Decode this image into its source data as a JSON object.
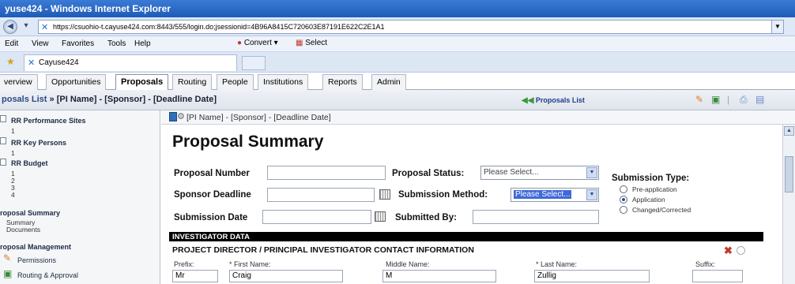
{
  "browser": {
    "title": "yuse424 - Windows Internet Explorer",
    "url": "https://csuohio-t.cayuse424.com:8443/555/login.do;jsessionid=4B96A8415C720603E87191E622C2E1A1",
    "menu": [
      "Edit",
      "View",
      "Favorites",
      "Tools",
      "Help"
    ],
    "convert_label": "Convert",
    "select_label": "Select",
    "tab_label": "Cayuse424"
  },
  "app_tabs": [
    "verview",
    "Opportunities",
    "Proposals",
    "Routing",
    "People",
    "Institutions",
    "Reports",
    "Admin"
  ],
  "breadcrumb": {
    "link": "posals List",
    "separator": "»",
    "rest": "[PI Name] - [Sponsor] - [Deadline Date]"
  },
  "proposals_list_link": "Proposals List",
  "sidebar": {
    "items": [
      {
        "label": "RR Performance Sites",
        "sub": [
          "1"
        ]
      },
      {
        "label": "RR Key Persons",
        "sub": [
          "1"
        ]
      },
      {
        "label": "RR Budget",
        "sub": [
          "1",
          "2",
          "3",
          "4"
        ]
      }
    ],
    "proposal_summary": {
      "title": "roposal Summary",
      "links": [
        "Summary",
        "Documents"
      ]
    },
    "proposal_management": {
      "title": "roposal Management",
      "links": [
        "Permissions",
        "Routing & Approval"
      ]
    }
  },
  "content": {
    "header": "[PI Name] - [Sponsor] - [Deadline Date]",
    "title": "Proposal Summary",
    "fields": {
      "proposal_number": "Proposal Number",
      "proposal_status": "Proposal Status:",
      "proposal_status_value": "Please Select...",
      "sponsor_deadline": "Sponsor Deadline",
      "submission_method": "Submission Method:",
      "submission_method_value": "Please Select...",
      "submission_date": "Submission Date",
      "submitted_by": "Submitted By:"
    },
    "submission_type": {
      "title": "Submission Type:",
      "options": [
        "Pre-application",
        "Application",
        "Changed/Corrected"
      ],
      "selected": "Application"
    },
    "investigator_bar": "INVESTIGATOR DATA",
    "pd_title": "PROJECT DIRECTOR / PRINCIPAL INVESTIGATOR CONTACT INFORMATION",
    "pd_labels": {
      "prefix": "Prefix:",
      "first": "* First Name:",
      "middle": "Middle Name:",
      "last": "* Last Name:",
      "suffix": "Suffix:"
    },
    "pd_values": {
      "prefix": "Mr",
      "first": "Craig",
      "middle": "M",
      "last": "Zullig",
      "suffix": ""
    }
  }
}
